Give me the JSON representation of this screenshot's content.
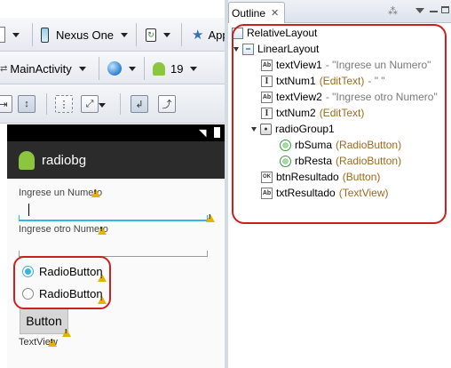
{
  "editor": {
    "device": "Nexus One",
    "app_label": "App",
    "activity": "MainActivity",
    "api_level": "19",
    "phone": {
      "app_title": "radiobg",
      "label_num1": "Ingrese un Numero",
      "label_num2": "Ingrese otro Numero",
      "radio1": "RadioButton",
      "radio2": "RadioButton",
      "button": "Button",
      "textview": "TextView",
      "radio1_checked": true
    }
  },
  "outline": {
    "tab_label": "Outline",
    "tree": [
      {
        "name": "RelativeLayout",
        "type": "",
        "text": ""
      },
      {
        "name": "LinearLayout",
        "type": "",
        "text": ""
      },
      {
        "name": "textView1",
        "type": "",
        "text": "- \"Ingrese un Numero\""
      },
      {
        "name": "txtNum1",
        "type": "(EditText)",
        "text": "- \" \""
      },
      {
        "name": "textView2",
        "type": "",
        "text": "- \"Ingrese otro Numero\""
      },
      {
        "name": "txtNum2",
        "type": "(EditText)",
        "text": ""
      },
      {
        "name": "radioGroup1",
        "type": "",
        "text": ""
      },
      {
        "name": "rbSuma",
        "type": "(RadioButton)",
        "text": ""
      },
      {
        "name": "rbResta",
        "type": "(RadioButton)",
        "text": ""
      },
      {
        "name": "btnResultado",
        "type": "(Button)",
        "text": ""
      },
      {
        "name": "txtResultado",
        "type": "(TextView)",
        "text": ""
      }
    ]
  },
  "colors": {
    "highlight_red": "#cc1f1f",
    "holo_blue": "#33b5e5",
    "type_text": "#9b6a1f"
  }
}
